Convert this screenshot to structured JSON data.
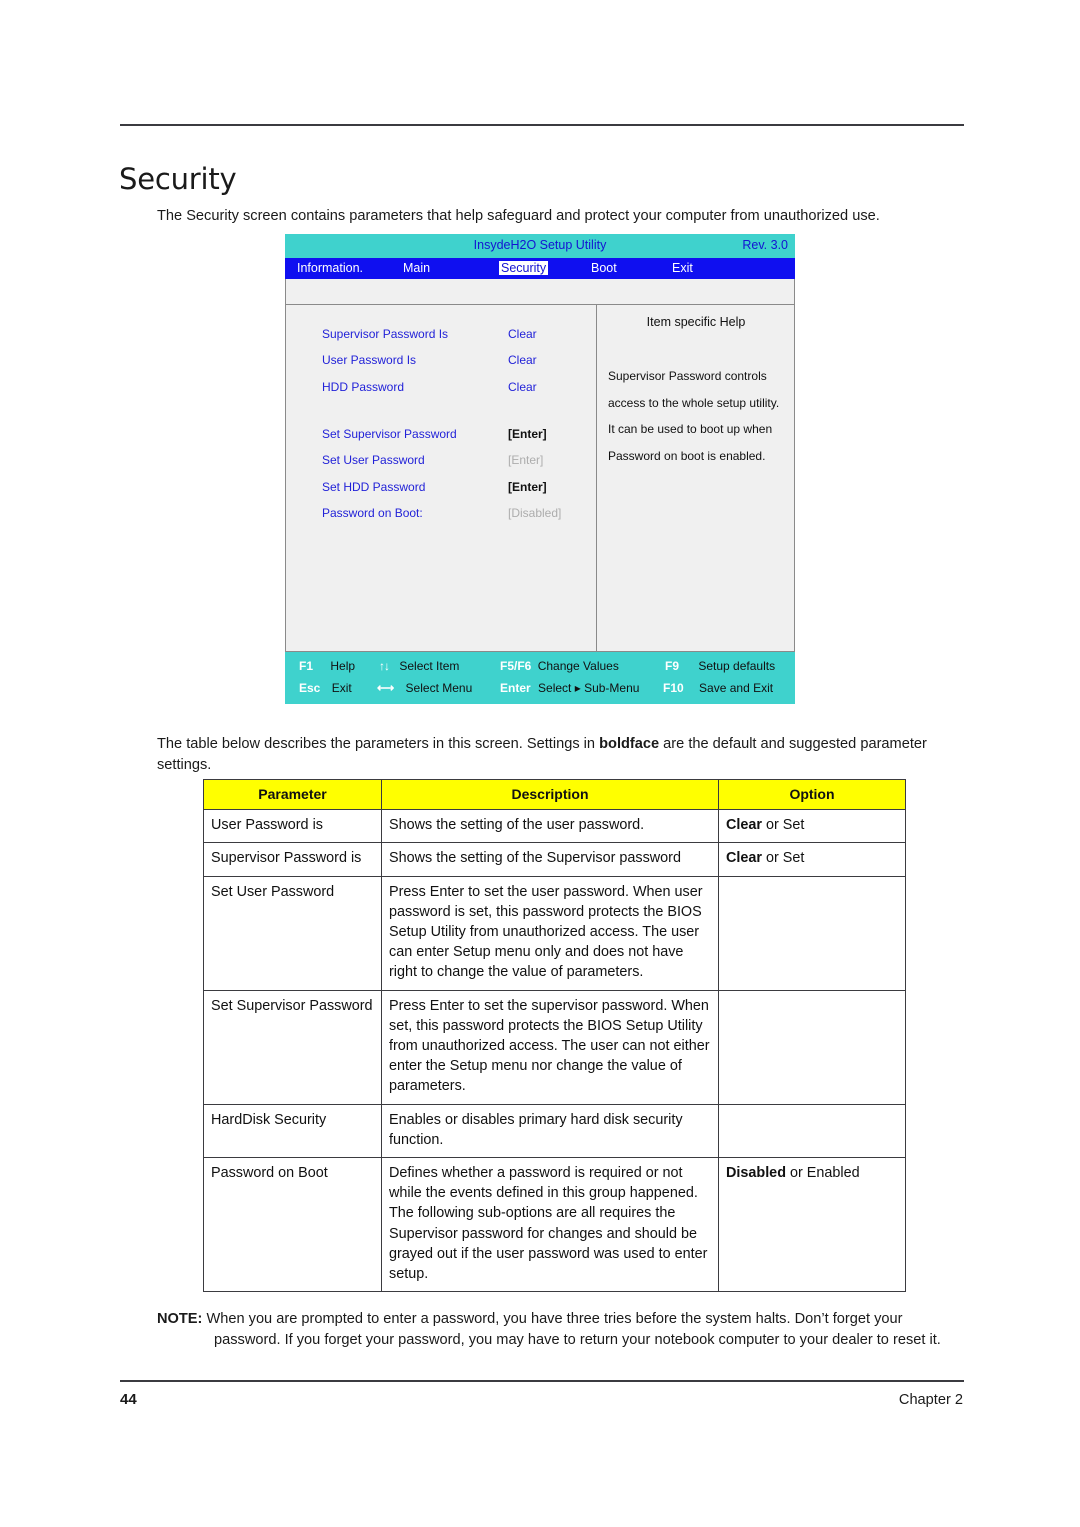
{
  "document": {
    "heading": "Security",
    "intro": "The Security screen contains parameters that help safeguard and protect your computer from unauthorized use.",
    "para2_before": "The table below describes the parameters in this screen. Settings in ",
    "para2_bold": "boldface",
    "para2_after": " are the default and suggested parameter settings.",
    "note_label": "NOTE:",
    "note_text": "When you are prompted to enter a password, you have three tries before the system halts. Don’t forget your password. If you forget your password, you may have to return your notebook computer to your dealer to reset it.",
    "page_number": "44",
    "chapter_label": "Chapter 2"
  },
  "bios": {
    "title": "InsydeH2O Setup Utility",
    "revision": "Rev. 3.0",
    "menu": [
      {
        "label": "Information.",
        "active": false
      },
      {
        "label": "Main",
        "active": false
      },
      {
        "label": "Security",
        "active": true
      },
      {
        "label": "Boot",
        "active": false
      },
      {
        "label": "Exit",
        "active": false
      }
    ],
    "settings": [
      {
        "label": "Supervisor Password Is",
        "value": "Clear",
        "style": "blue"
      },
      {
        "label": "User Password Is",
        "value": "Clear",
        "style": "blue"
      },
      {
        "label": "HDD Password",
        "value": "Clear",
        "style": "blue"
      },
      {
        "label": "Set Supervisor Password",
        "value": "[Enter]",
        "style": "black"
      },
      {
        "label": "Set User Password",
        "value": "[Enter]",
        "style": "gray"
      },
      {
        "label": "Set HDD Password",
        "value": "[Enter]",
        "style": "black"
      },
      {
        "label": "Password on Boot:",
        "value": "[Disabled]",
        "style": "gray"
      }
    ],
    "help": {
      "title": "Item specific Help",
      "body": "Supervisor Password controls access to the whole setup utility. It can be used to boot up when Password on boot is enabled."
    },
    "footer": {
      "row1": [
        {
          "key": "F1",
          "glyph": "",
          "label": "Help"
        },
        {
          "key": "",
          "glyph": "↑↓",
          "label": "Select Item"
        },
        {
          "key": "F5/F6",
          "glyph": "",
          "label": "Change Values"
        },
        {
          "key": "F9",
          "glyph": "",
          "label": "Setup defaults"
        }
      ],
      "row2": [
        {
          "key": "Esc",
          "glyph": "",
          "label": "Exit"
        },
        {
          "key": "",
          "glyph": "⟷",
          "label": "Select Menu"
        },
        {
          "key": "Enter",
          "glyph": "",
          "label": "Select ▸ Sub-Menu"
        },
        {
          "key": "F10",
          "glyph": "",
          "label": "Save and Exit"
        }
      ]
    },
    "colors": {
      "titlebar_bg": "#3fd2cd",
      "menubar_bg": "#0f0ff0",
      "link_text": "#2222d8",
      "panel_bg": "#f0f0f0"
    }
  },
  "table": {
    "headers": [
      "Parameter",
      "Description",
      "Option"
    ],
    "header_bg": "#ffff00",
    "rows": [
      {
        "parameter": "User Password is",
        "description": "Shows the setting of the user password.",
        "option_bold": "Clear",
        "option_rest": " or Set"
      },
      {
        "parameter": "Supervisor Password is",
        "description": "Shows the setting of the Supervisor password",
        "option_bold": "Clear",
        "option_rest": " or Set"
      },
      {
        "parameter": "Set User Password",
        "description": "Press Enter to set the user password. When user password is set, this password protects the BIOS Setup Utility from unauthorized access. The user can enter Setup menu only and does not have right to change the value of parameters.",
        "option_bold": "",
        "option_rest": ""
      },
      {
        "parameter": "Set Supervisor Password",
        "description": "Press Enter to set the supervisor password. When set, this password protects the BIOS Setup Utility from unauthorized access. The user can not either enter the Setup menu nor change the value of parameters.",
        "option_bold": "",
        "option_rest": ""
      },
      {
        "parameter": "HardDisk Security",
        "description": "Enables or disables primary hard disk security function.",
        "option_bold": "",
        "option_rest": ""
      },
      {
        "parameter": "Password on Boot",
        "description": "Defines whether a password is required or not while the events defined in this group happened. The following sub-options are all requires the Supervisor password for changes and should be grayed out if the user password was used to enter setup.",
        "option_bold": "Disabled",
        "option_rest": " or Enabled"
      }
    ]
  }
}
